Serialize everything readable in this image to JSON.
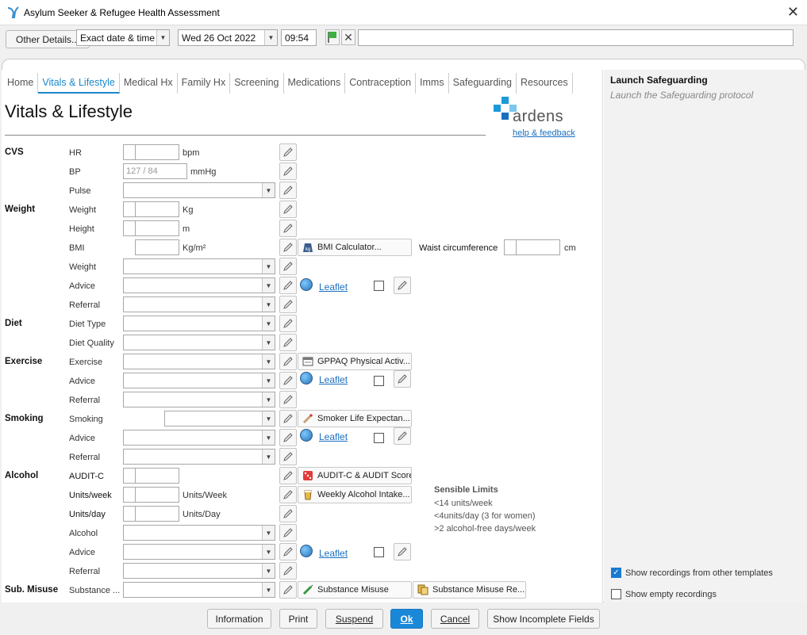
{
  "window": {
    "title": "Asylum Seeker & Refugee Health Assessment"
  },
  "toolbar": {
    "other_details": "Other Details...",
    "date_mode": "Exact date & time",
    "date": "Wed 26 Oct 2022",
    "time": "09:54",
    "free_text": ""
  },
  "tabs": [
    "Home",
    "Vitals & Lifestyle",
    "Medical Hx",
    "Family Hx",
    "Screening",
    "Medications",
    "Contraception",
    "Imms",
    "Safeguarding",
    "Resources"
  ],
  "page": {
    "title": "Vitals & Lifestyle",
    "brand": "ardens",
    "help_link": "help & feedback"
  },
  "sections": {
    "cvs": "CVS",
    "weight": "Weight",
    "diet": "Diet",
    "exercise": "Exercise",
    "smoking": "Smoking",
    "alcohol": "Alcohol",
    "sub_misuse": "Sub. Misuse"
  },
  "labels": {
    "hr": "HR",
    "bp": "BP",
    "pulse": "Pulse",
    "weight": "Weight",
    "height": "Height",
    "bmi": "BMI",
    "weight2": "Weight",
    "advice": "Advice",
    "referral": "Referral",
    "diet_type": "Diet Type",
    "diet_quality": "Diet Quality",
    "exercise": "Exercise",
    "smoking": "Smoking",
    "audit_c": "AUDIT-C",
    "units_week": "Units/week",
    "units_day": "Units/day",
    "alcohol": "Alcohol",
    "substance": "Substance ...",
    "waist": "Waist circumference"
  },
  "units": {
    "bpm": "bpm",
    "mmhg": "mmHg",
    "kg": "Kg",
    "m": "m",
    "kgm2": "Kg/m²",
    "cm": "cm",
    "units_week": "Units/Week",
    "units_day": "Units/Day"
  },
  "placeholders": {
    "bp": "127 / 84"
  },
  "tools": {
    "bmi_calc": "BMI Calculator...",
    "gppaq": "GPPAQ Physical Activ...",
    "smoker_le": "Smoker Life Expectan...",
    "audit_score": "AUDIT-C & AUDIT Score",
    "alcohol_intake": "Weekly Alcohol Intake...",
    "substance_misuse": "Substance Misuse",
    "substance_misuse_re": "Substance Misuse Re..."
  },
  "leaflet": "Leaflet",
  "limits": {
    "title": "Sensible Limits",
    "l1": "<14 units/week",
    "l2": "<4units/day (3 for women)",
    "l3": ">2 alcohol-free days/week"
  },
  "side": {
    "title": "Launch Safeguarding",
    "subtitle": "Launch the Safeguarding protocol",
    "show_other": "Show recordings from other templates",
    "show_empty": "Show empty recordings"
  },
  "bottom": {
    "information": "Information",
    "print": "Print",
    "suspend": "Suspend",
    "ok": "Ok",
    "cancel": "Cancel",
    "show_incomplete": "Show Incomplete Fields"
  },
  "colors": {
    "accent": "#1a88c9",
    "ok_button": "#1a88d8"
  }
}
